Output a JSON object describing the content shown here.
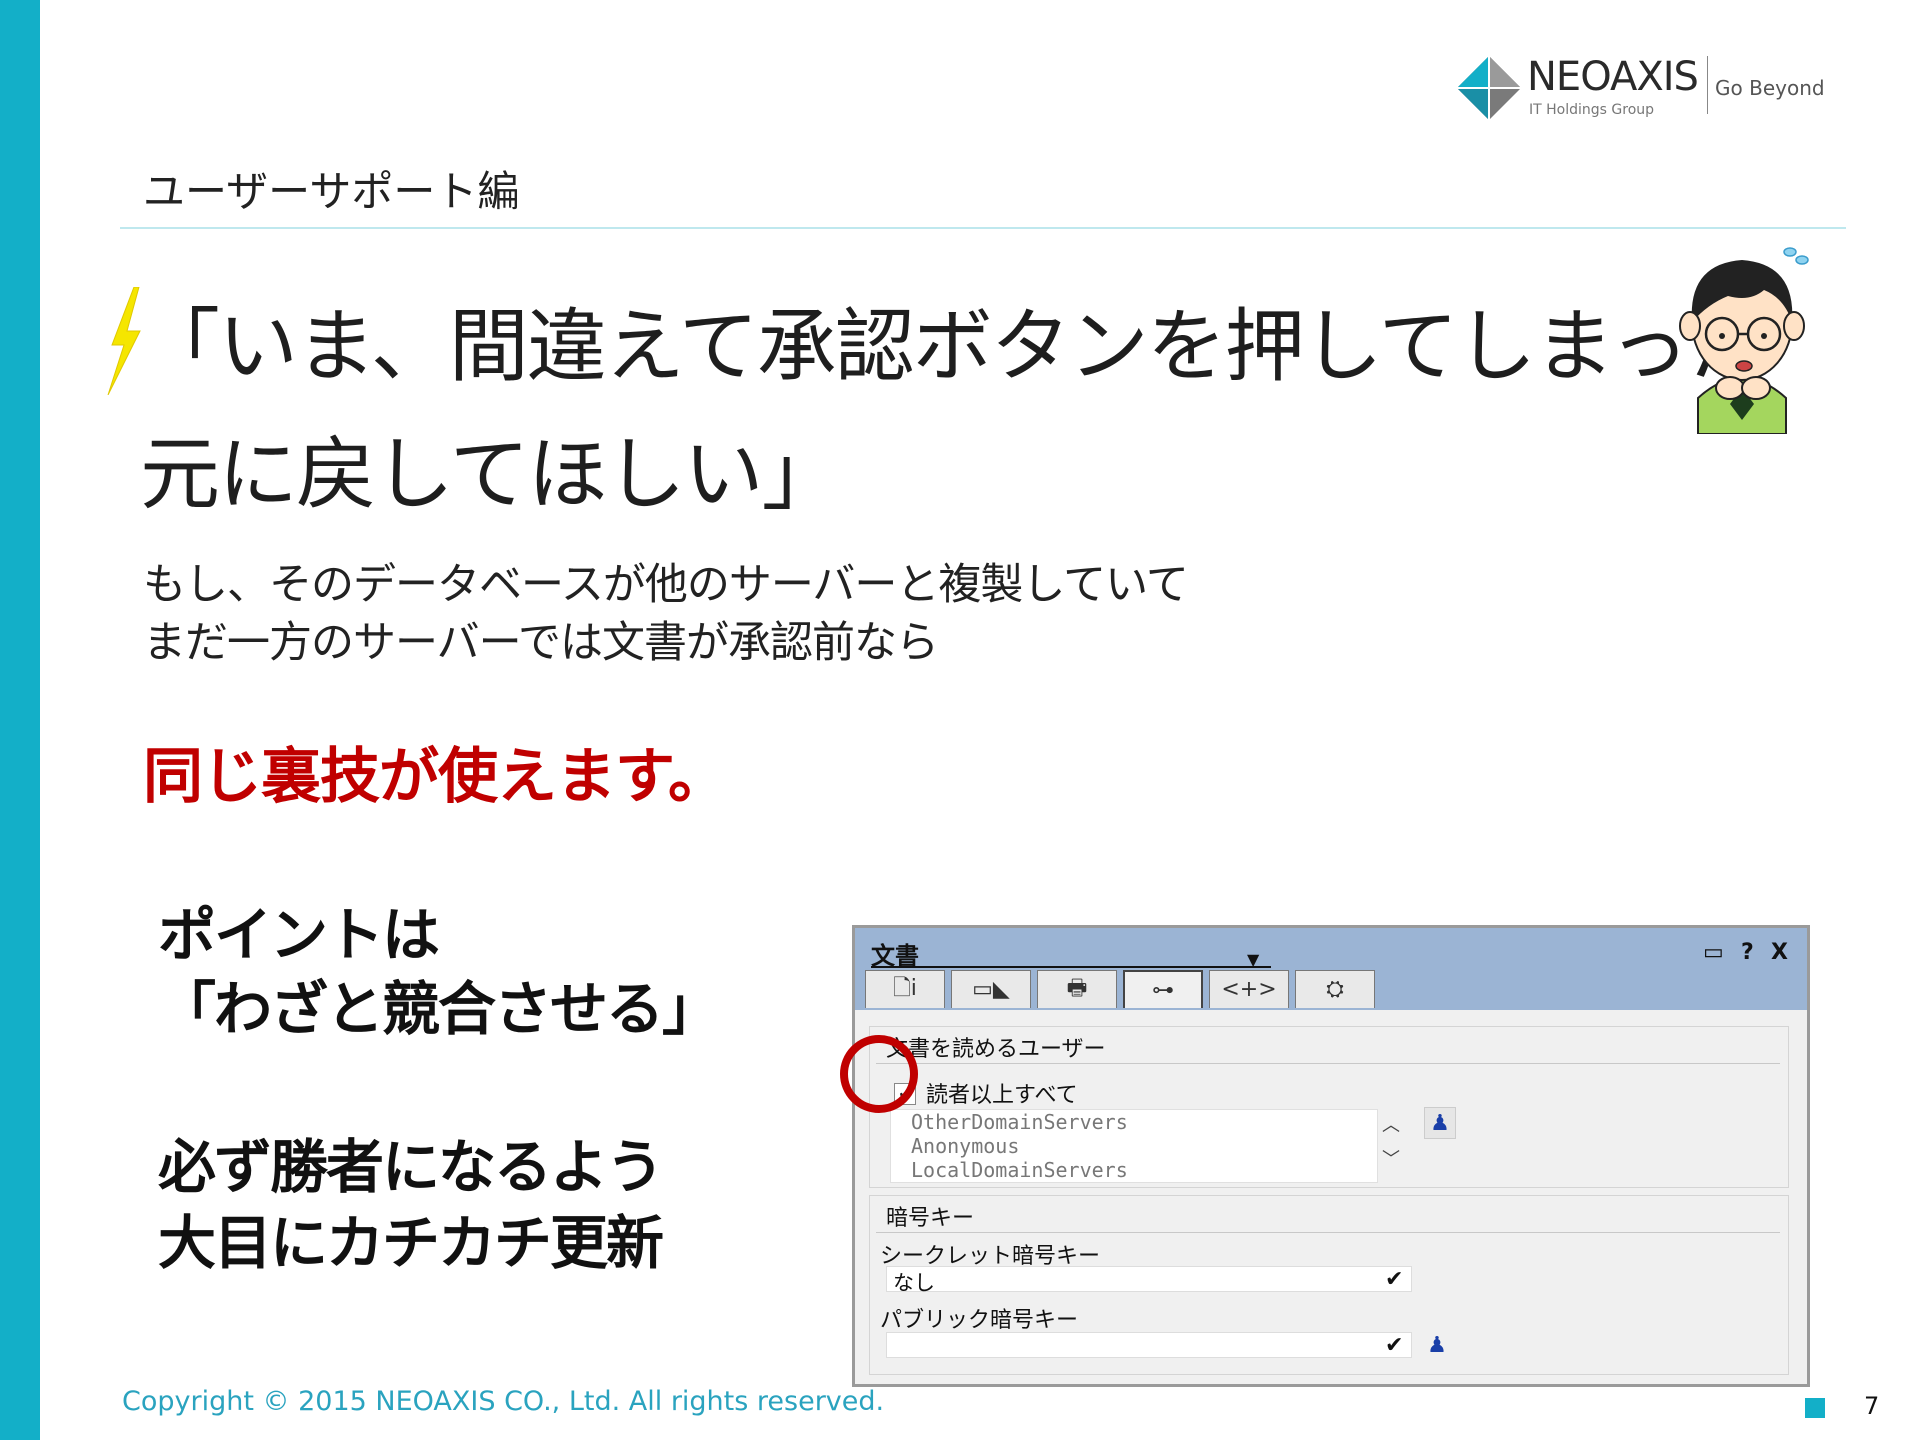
{
  "logo": {
    "name": "NEOAXIS",
    "sub": "IT Holdings Group",
    "tagline": "Go Beyond"
  },
  "section_title": "ユーザーサポート編",
  "quote": {
    "line1": "「いま、間違えて承認ボタンを押してしまった",
    "line2": "元に戻してほしい」"
  },
  "body": {
    "line1": "もし、そのデータベースが他のサーバーと複製していて",
    "line2": "まだ一方のサーバーでは文書が承認前なら"
  },
  "highlight": "同じ裏技が使えます。",
  "points": {
    "a": "ポイントは",
    "b": "「わざと競合させる」",
    "c": "必ず勝者になるよう",
    "d": "大目にカチカチ更新"
  },
  "dialog": {
    "title": "文書",
    "controls": [
      "▭",
      "?",
      "X"
    ],
    "tabs": [
      "🗋ⅰ",
      "▭◣",
      "🖶",
      "⊶",
      "<+>",
      "⛭"
    ],
    "readers_group": {
      "label": "文書を読めるユーザー",
      "checkbox_label": "読者以上すべて",
      "checkbox_checked": true,
      "list": [
        "OtherDomainServers",
        "Anonymous",
        "LocalDomainServers"
      ]
    },
    "encryption_group": {
      "label": "暗号キー",
      "secret_label": "シークレット暗号キー",
      "secret_value": "なし",
      "public_label": "パブリック暗号キー",
      "public_value": ""
    }
  },
  "colors": {
    "accent": "#13afc8",
    "highlight": "#c00000",
    "dialog_header": "#9bb4d4"
  },
  "footer": {
    "copyright": "Copyright © 2015 NEOAXIS CO., Ltd. All rights reserved.",
    "page": "7"
  }
}
